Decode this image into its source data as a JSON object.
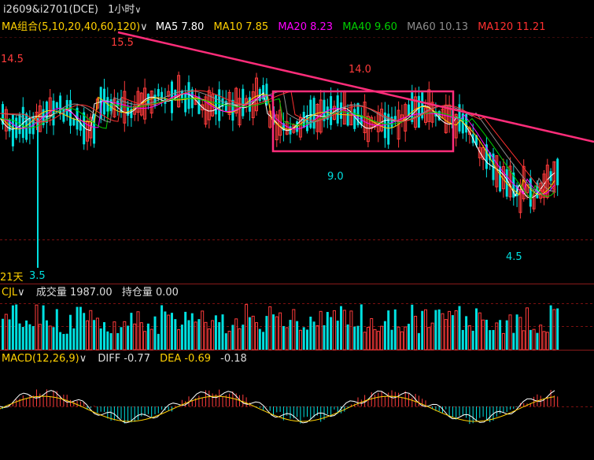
{
  "header": {
    "symbol": "i2609&i2701(DCE)",
    "period": "1小时",
    "chevron": "∨"
  },
  "ma_bar": {
    "label": "MA组合(5,10,20,40,60,120)",
    "chevron": "∨",
    "items": [
      {
        "text": "MA5 7.80",
        "color": "#ffffff"
      },
      {
        "text": "MA10 7.85",
        "color": "#ffd000"
      },
      {
        "text": "MA20 8.23",
        "color": "#ff00ff"
      },
      {
        "text": "MA40 9.60",
        "color": "#00d000"
      },
      {
        "text": "MA60 10.13",
        "color": "#8c8c8c"
      },
      {
        "text": "MA120 11.21",
        "color": "#ff3030"
      }
    ]
  },
  "price_labels": {
    "high_left": "14.5",
    "peak": "15.5",
    "mid_high": "14.0",
    "mid_low": "9.0",
    "low_right": "4.5",
    "low_left": "3.5",
    "days": "21天"
  },
  "volume_bar": {
    "label": "CJL",
    "chevron": "∨",
    "volume_text": "成交量 1987.00",
    "oi_text": "持仓量 0.00"
  },
  "macd_bar": {
    "label": "MACD(12,26,9)",
    "chevron": "∨",
    "diff": "DIFF -0.77",
    "dea": "DEA -0.69",
    "macd": "-0.18"
  },
  "colors": {
    "up": "#ff3b3b",
    "down": "#00e0e0",
    "trend": "#ff2d7a",
    "grid": "#7a1010"
  }
}
